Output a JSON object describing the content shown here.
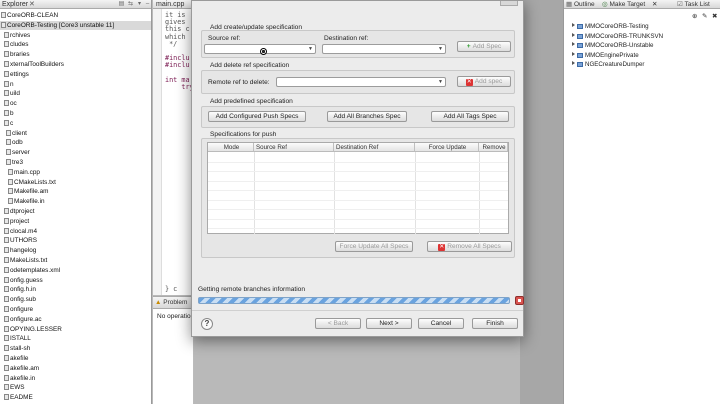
{
  "explorer": {
    "tab_label": "Explorer",
    "close_glyph": "✕",
    "items": [
      {
        "label": "CoreORB-CLEAN",
        "selected": false
      },
      {
        "label": "CoreORB-Testing [Core3 unstable 11]",
        "selected": true
      },
      {
        "label": "rchives",
        "selected": false
      },
      {
        "label": "cludes",
        "selected": false
      },
      {
        "label": "braries",
        "selected": false
      },
      {
        "label": "xternalToolBuilders",
        "selected": false
      },
      {
        "label": "ettings",
        "selected": false
      },
      {
        "label": "n",
        "selected": false
      },
      {
        "label": "uild",
        "selected": false
      },
      {
        "label": "oc",
        "selected": false
      },
      {
        "label": "b",
        "selected": false
      },
      {
        "label": "c",
        "selected": false
      },
      {
        "label": "client",
        "selected": false
      },
      {
        "label": "odb",
        "selected": false
      },
      {
        "label": "server",
        "selected": false
      },
      {
        "label": "tre3",
        "selected": false
      },
      {
        "label": "main.cpp",
        "selected": false
      },
      {
        "label": "CMakeLists.txt",
        "selected": false
      },
      {
        "label": "Makefile.am",
        "selected": false
      },
      {
        "label": "Makefile.in",
        "selected": false
      },
      {
        "label": "dtproject",
        "selected": false
      },
      {
        "label": "project",
        "selected": false
      },
      {
        "label": "clocal.m4",
        "selected": false
      },
      {
        "label": "UTHORS",
        "selected": false
      },
      {
        "label": "hangelog",
        "selected": false
      },
      {
        "label": "MakeLists.txt",
        "selected": false
      },
      {
        "label": "odetemplates.xml",
        "selected": false
      },
      {
        "label": "onfig.guess",
        "selected": false
      },
      {
        "label": "onfig.h.in",
        "selected": false
      },
      {
        "label": "onfig.sub",
        "selected": false
      },
      {
        "label": "onfigure",
        "selected": false
      },
      {
        "label": "onfigure.ac",
        "selected": false
      },
      {
        "label": "OPYING.LESSER",
        "selected": false
      },
      {
        "label": "ISTALL",
        "selected": false
      },
      {
        "label": "stall-sh",
        "selected": false
      },
      {
        "label": "akefile",
        "selected": false
      },
      {
        "label": "akefile.am",
        "selected": false
      },
      {
        "label": "akefile.in",
        "selected": false
      },
      {
        "label": "EWS",
        "selected": false
      },
      {
        "label": "EADME",
        "selected": false
      }
    ]
  },
  "editor": {
    "tab_label": "main.cpp",
    "lines": [
      "it is",
      "gives",
      "this c",
      "which",
      " */",
      "",
      "#inclu",
      "#inclu",
      "",
      "int ma",
      "    try",
      "",
      "",
      "",
      "",
      "",
      "",
      "",
      "",
      "",
      "",
      "",
      "",
      "",
      "",
      "",
      "",
      "",
      "",
      "",
      "",
      "",
      "",
      "",
      "",
      "",
      "",
      "",
      "} c"
    ]
  },
  "problems": {
    "tab_label": "Problem",
    "body_text": "No operatio"
  },
  "rightpane": {
    "tabs": [
      "Outline",
      "Make Target",
      "Task List"
    ],
    "items": [
      "MMOCoreORB-Testing",
      "MMOCoreORB-TRUNKSVN",
      "MMOCoreORB-Unstable",
      "MMOEnginePrivate",
      "NGECreatureDumper"
    ]
  },
  "dialog": {
    "create_update": {
      "title": "Add create/update specification",
      "source_label": "Source ref:",
      "dest_label": "Destination ref:",
      "source_value": "",
      "dest_value": "",
      "add_button": "Add Spec"
    },
    "delete": {
      "title": "Add delete ref specification",
      "remote_label": "Remote ref to delete:",
      "remote_value": "",
      "add_button": "Add spec"
    },
    "predefined": {
      "title": "Add predefined specification",
      "buttons": [
        "Add Configured Push Specs",
        "Add All Branches Spec",
        "Add All Tags Spec"
      ]
    },
    "table": {
      "title": "Specifications for push",
      "columns": [
        "Mode",
        "Source Ref",
        "Destination Ref",
        "Force Update",
        "Remove"
      ]
    },
    "actions": {
      "force_update": "Force Update All Specs",
      "remove_all": "Remove All Specs"
    },
    "progress": {
      "label": "Getting remote branches information"
    },
    "footer": {
      "help": "?",
      "back": "< Back",
      "next": "Next >",
      "cancel": "Cancel",
      "finish": "Finish"
    }
  }
}
